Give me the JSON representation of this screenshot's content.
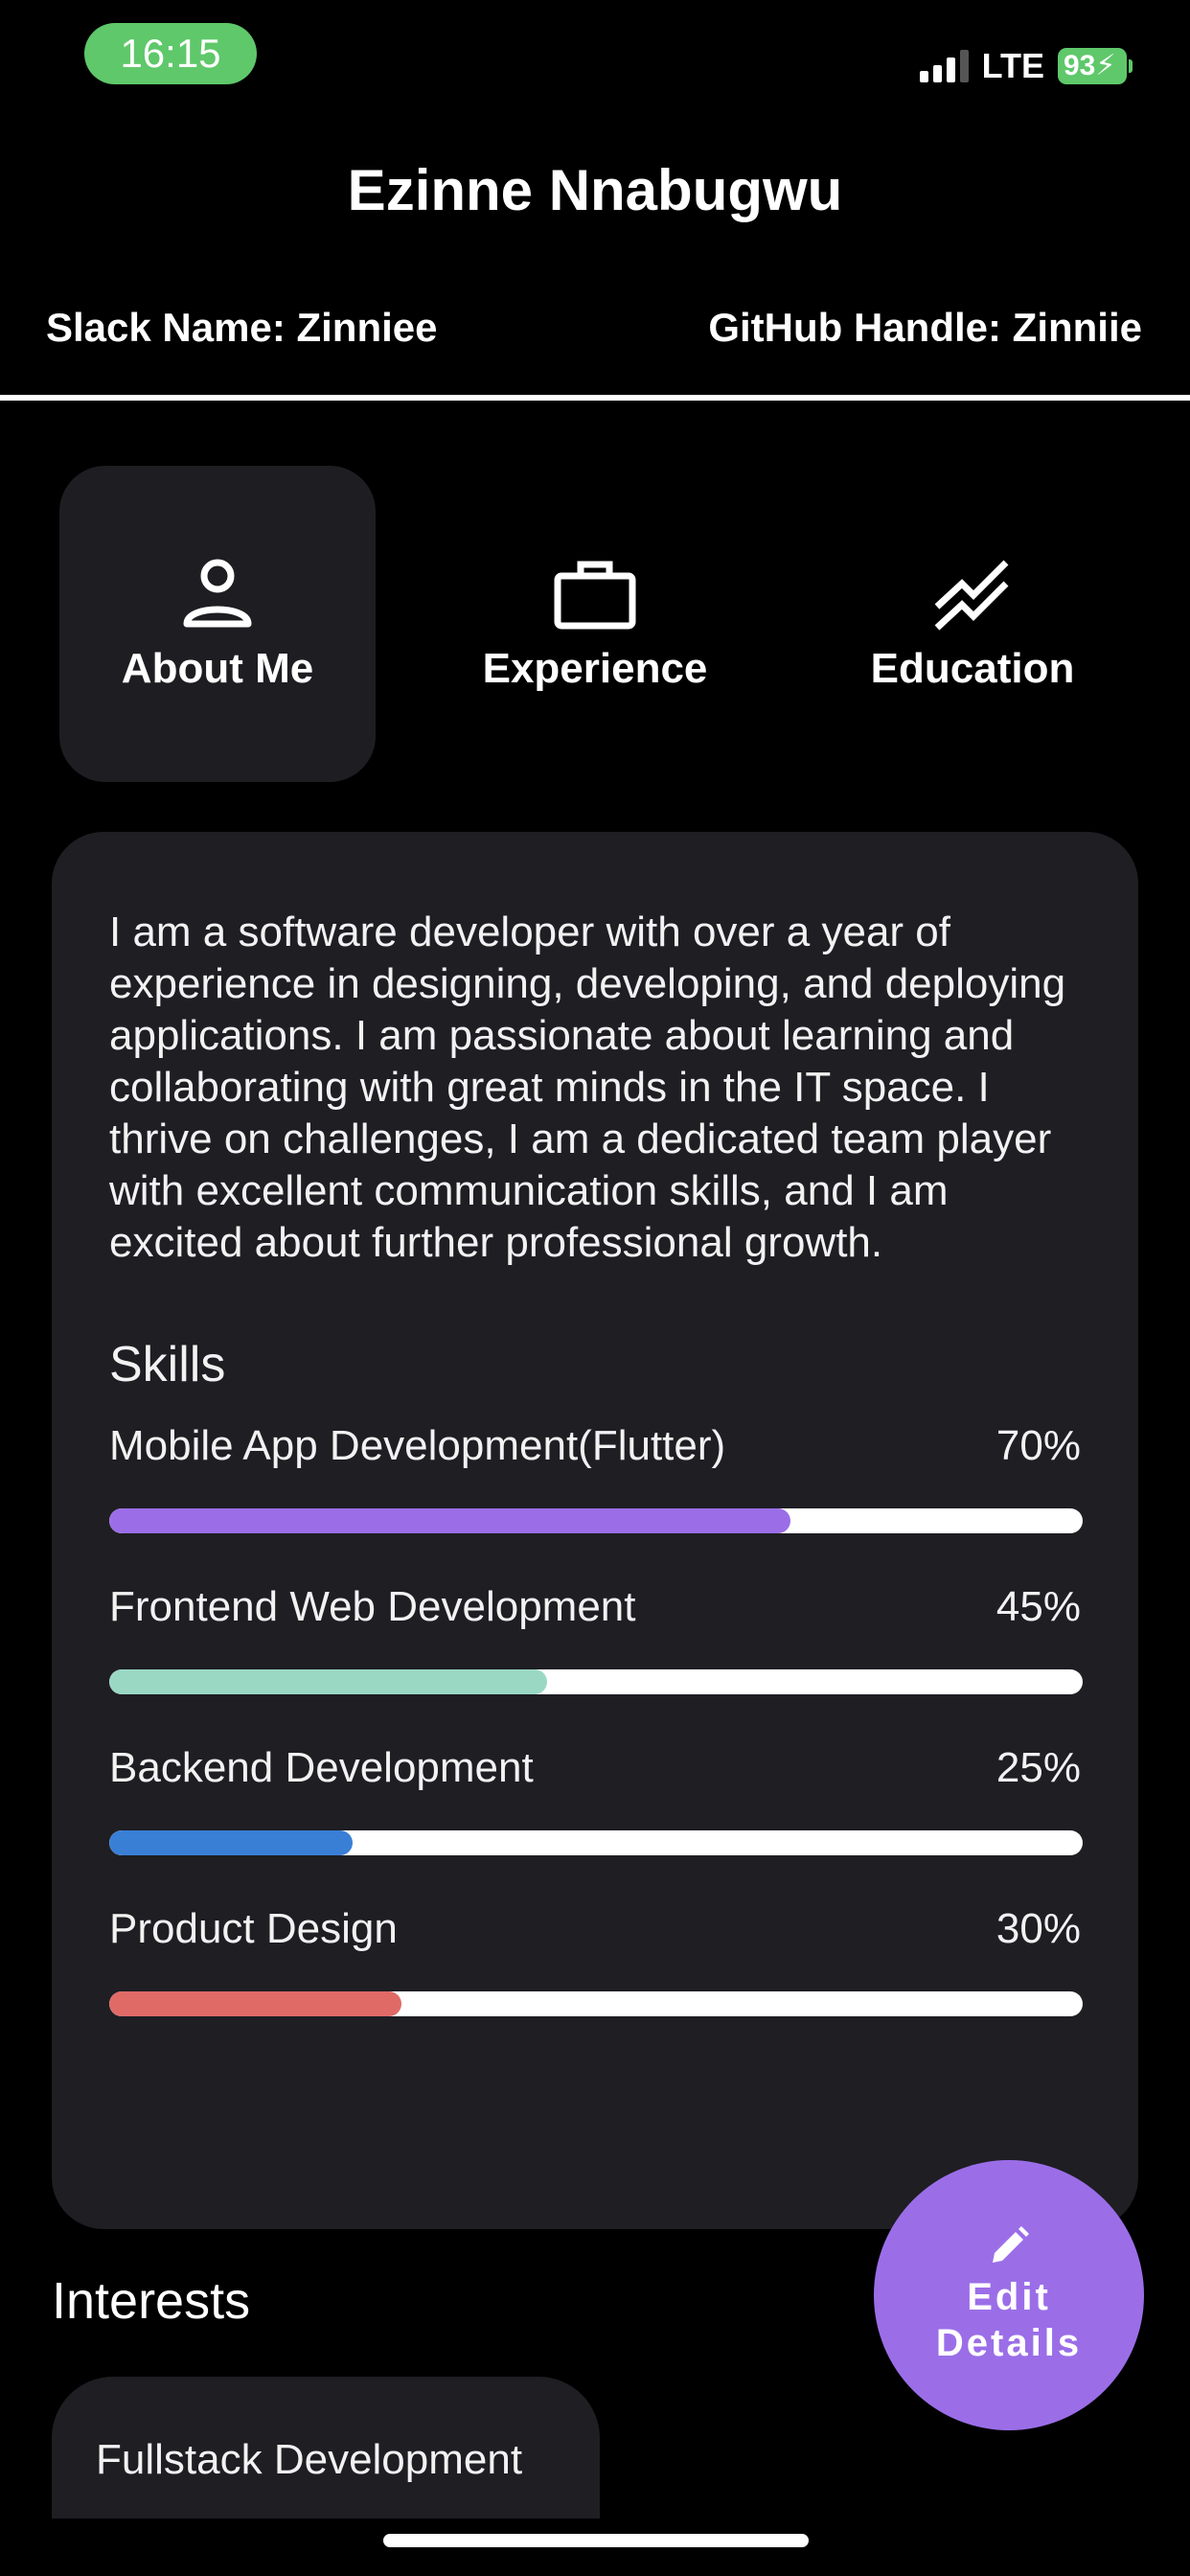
{
  "status_bar": {
    "time": "16:15",
    "network": "LTE",
    "battery": "93"
  },
  "header": {
    "name": "Ezinne Nnabugwu",
    "slack": "Slack Name: Zinniee",
    "github": "GitHub Handle: Zinniie"
  },
  "tabs": [
    {
      "label": "About Me",
      "icon": "person-icon",
      "active": true
    },
    {
      "label": "Experience",
      "icon": "briefcase-icon",
      "active": false
    },
    {
      "label": "Education",
      "icon": "trend-icon",
      "active": false
    }
  ],
  "about": {
    "text": "I am a software developer with over a year of experience in designing, developing, and deploying applications. I am passionate about learning and collaborating with great minds in the IT space. I thrive on challenges, I am a dedicated team player with excellent communication skills, and I am excited about further professional growth."
  },
  "skills": {
    "title": "Skills",
    "items": [
      {
        "name": "Mobile App Development(Flutter)",
        "percent_label": "70%",
        "value": 0.7,
        "color": "#9b6ee8"
      },
      {
        "name": "Frontend Web Development",
        "percent_label": "45%",
        "value": 0.45,
        "color": "#9ad8c4"
      },
      {
        "name": "Backend Development",
        "percent_label": "25%",
        "value": 0.25,
        "color": "#3a7fd6"
      },
      {
        "name": "Product Design",
        "percent_label": "30%",
        "value": 0.3,
        "color": "#e06a66"
      }
    ]
  },
  "interests": {
    "title": "Interests",
    "items": [
      "Fullstack Development"
    ]
  },
  "fab": {
    "label_line1": "Edit",
    "label_line2": "Details",
    "icon": "pencil-icon"
  }
}
